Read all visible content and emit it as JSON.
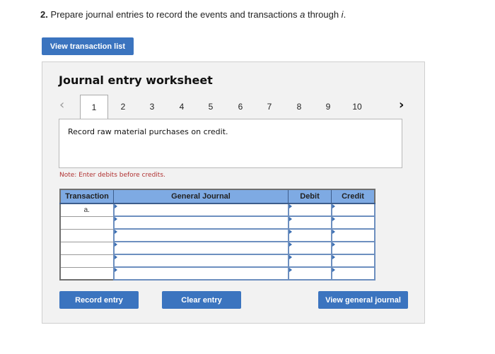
{
  "question": {
    "number": "2.",
    "text_before": " Prepare journal entries to record the events and transactions ",
    "first_letter": "a",
    "text_middle": " through ",
    "last_letter": "i",
    "text_after": "."
  },
  "buttons": {
    "view_transaction_list": "View transaction list",
    "record_entry": "Record entry",
    "clear_entry": "Clear entry",
    "view_general_journal": "View general journal"
  },
  "worksheet": {
    "title": "Journal entry worksheet",
    "prev_icon": "chevron-left-icon",
    "next_icon": "chevron-right-icon",
    "tabs": [
      "1",
      "2",
      "3",
      "4",
      "5",
      "6",
      "7",
      "8",
      "9",
      "10"
    ],
    "active_tab": "1",
    "prompt": "Record raw material purchases on credit.",
    "note": "Note: Enter debits before credits.",
    "table": {
      "headers": [
        "Transaction",
        "General Journal",
        "Debit",
        "Credit"
      ],
      "rows": [
        {
          "transaction": "a.",
          "account": "",
          "debit": "",
          "credit": ""
        },
        {
          "transaction": "",
          "account": "",
          "debit": "",
          "credit": ""
        },
        {
          "transaction": "",
          "account": "",
          "debit": "",
          "credit": ""
        },
        {
          "transaction": "",
          "account": "",
          "debit": "",
          "credit": ""
        },
        {
          "transaction": "",
          "account": "",
          "debit": "",
          "credit": ""
        },
        {
          "transaction": "",
          "account": "",
          "debit": "",
          "credit": ""
        }
      ]
    }
  },
  "colors": {
    "button_blue": "#3b74bf",
    "header_blue": "#7eaae3",
    "note_red": "#b03030"
  }
}
